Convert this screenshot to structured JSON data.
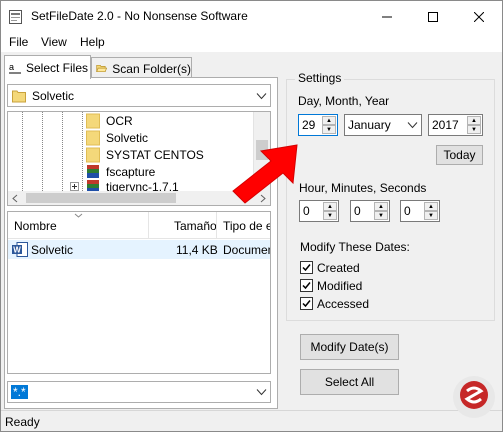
{
  "window": {
    "title": "SetFileDate 2.0 - No Nonsense Software"
  },
  "menu": {
    "items": [
      "File",
      "View",
      "Help"
    ]
  },
  "tabs": [
    {
      "label": "Select Files"
    },
    {
      "label": "Scan Folder(s)"
    }
  ],
  "drive_combo": {
    "value": "Solvetic"
  },
  "tree": {
    "items": [
      "OCR",
      "Solvetic",
      "SYSTAT CENTOS",
      "fscapture",
      "tigervnc-1.7.1"
    ]
  },
  "file_list": {
    "columns": [
      "Nombre",
      "Tamaño",
      "Tipo de el"
    ],
    "rows": [
      {
        "name": "Solvetic",
        "size": "11,4 KB",
        "type": "Document"
      }
    ]
  },
  "filter_combo": {
    "value": "*.*"
  },
  "settings": {
    "title": "Settings",
    "date_label": "Day, Month, Year",
    "day": "29",
    "month": "January",
    "year": "2017",
    "today_label": "Today",
    "time_label": "Hour, Minutes, Seconds",
    "hour": "0",
    "minutes": "0",
    "seconds": "0",
    "modify_label": "Modify These Dates:",
    "checks": [
      {
        "label": "Created",
        "checked": true
      },
      {
        "label": "Modified",
        "checked": true
      },
      {
        "label": "Accessed",
        "checked": true
      }
    ]
  },
  "actions": {
    "modify_label": "Modify Date(s)",
    "select_all_label": "Select All"
  },
  "status": {
    "text": "Ready"
  },
  "colors": {
    "arrow": "#ff0000",
    "selection": "#e5f3ff",
    "folder": "#f4d87a",
    "word_blue": "#2b579a"
  }
}
